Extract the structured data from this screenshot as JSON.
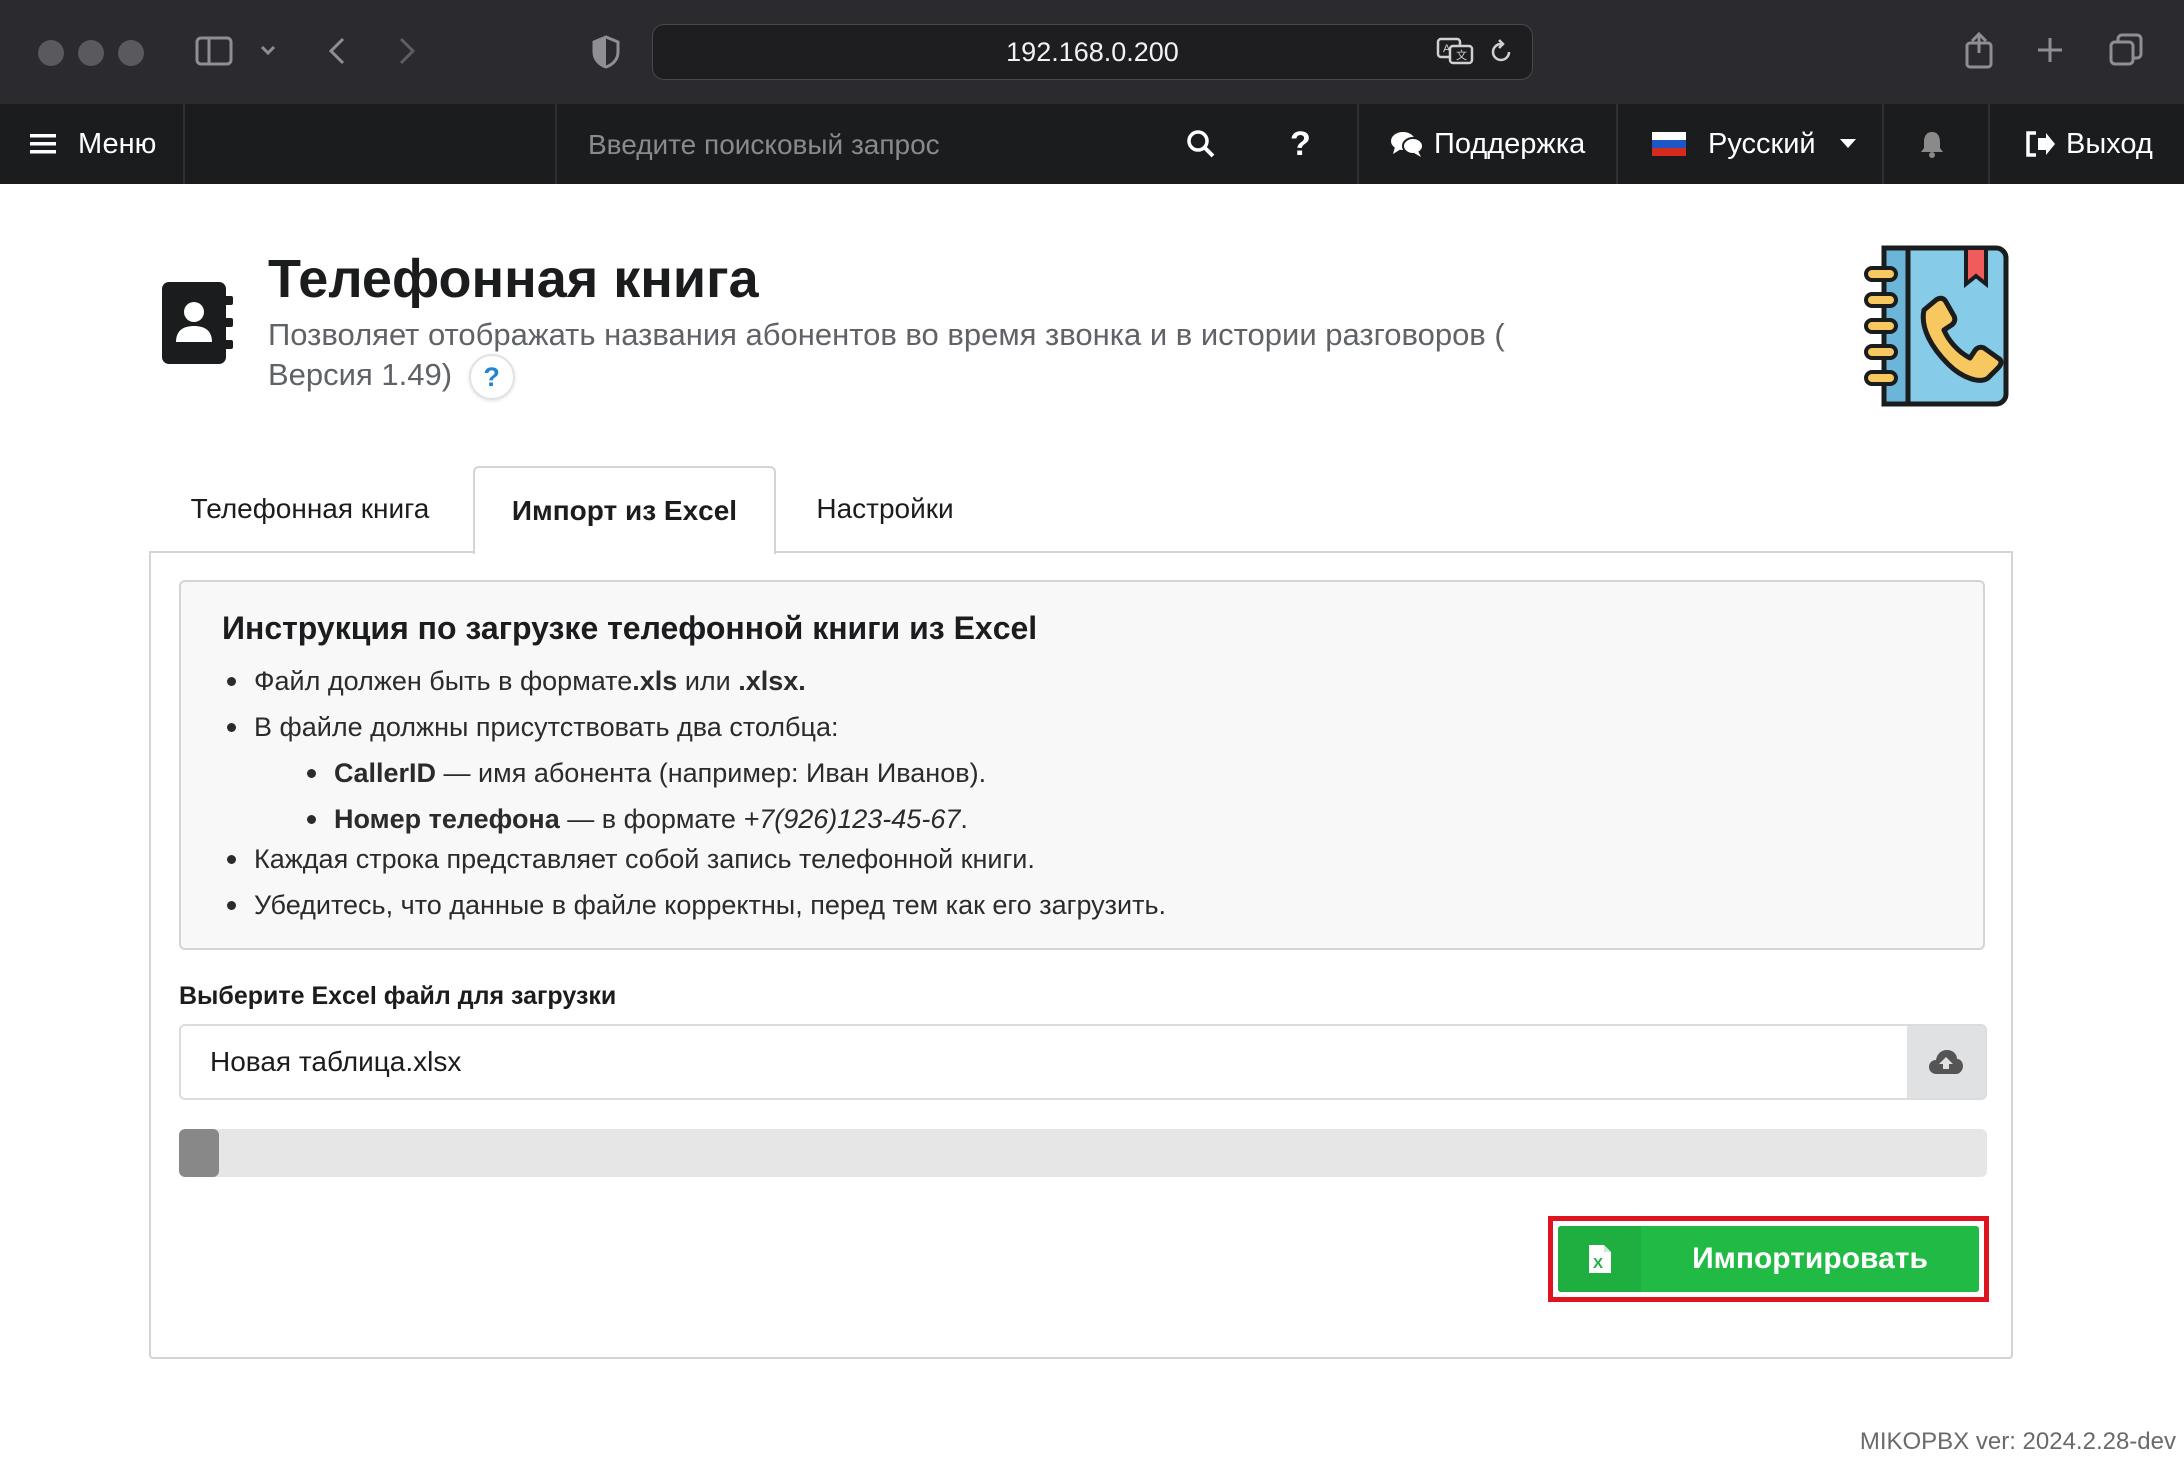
{
  "browser": {
    "url": "192.168.0.200"
  },
  "topmenu": {
    "menu_label": "Меню",
    "search_placeholder": "Введите поисковый запрос",
    "help_label": "?",
    "support_label": "Поддержка",
    "language_label": "Русский",
    "logout_label": "Выход"
  },
  "header": {
    "title": "Телефонная книга",
    "subtitle_line1": "Позволяет отображать названия абонентов во время звонка и в истории разговоров (",
    "subtitle_line2": "Версия 1.49)",
    "help_icon_text": "?"
  },
  "tabs": [
    {
      "label": "Телефонная книга",
      "active": false
    },
    {
      "label": "Импорт из Excel",
      "active": true
    },
    {
      "label": "Настройки",
      "active": false
    }
  ],
  "instructions": {
    "title": "Инструкция по загрузке телефонной книги из Excel",
    "item1_prefix": "Файл должен быть в формате ",
    "item1_xls": ".xls",
    "item1_mid": " или ",
    "item1_xlsx": ".xlsx.",
    "item2": "В файле должны присутствовать два столбца:",
    "sub1_bold": "CallerID",
    "sub1_rest": " — имя абонента (например: Иван Иванов).",
    "sub2_bold": "Номер телефона",
    "sub2_mid": " — в формате ",
    "sub2_italic": "+7(926)123-45-67",
    "sub2_end": ".",
    "item3": "Каждая строка представляет собой запись телефонной книги.",
    "item4": "Убедитесь, что данные в файле корректны, перед тем как его загрузить."
  },
  "upload": {
    "label": "Выберите Excel файл для загрузки",
    "file_name": "Новая таблица.xlsx",
    "progress_fraction": 0.022
  },
  "import_button": {
    "label": "Импортировать"
  },
  "footer": {
    "version": "MIKOPBX ver: 2024.2.28-dev"
  },
  "colors": {
    "topmenu_bg": "#1b1c1d",
    "import_green": "#21ba45",
    "highlight_red": "#e0141e",
    "help_blue": "#2185d0"
  }
}
